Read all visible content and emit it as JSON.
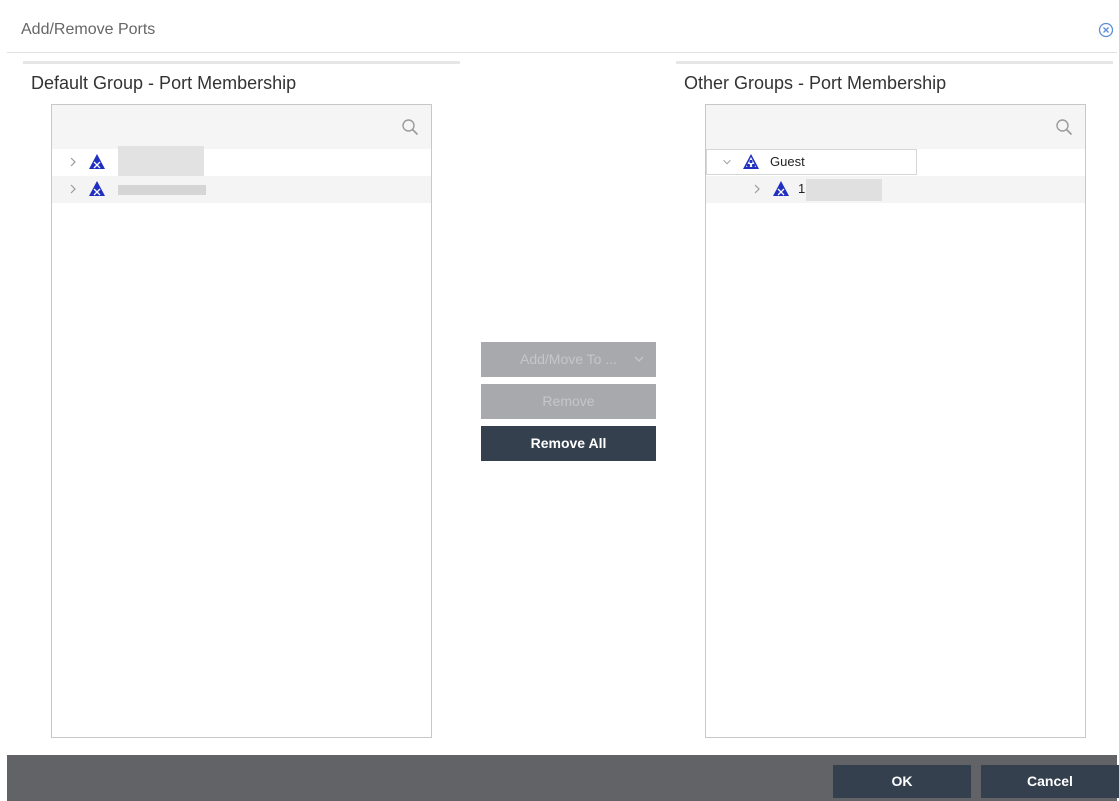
{
  "dialog": {
    "title": "Add/Remove Ports",
    "close_icon": "close-circle-icon"
  },
  "left_panel": {
    "heading": "Default Group - Port Membership",
    "search": {
      "value": "",
      "placeholder": ""
    },
    "nodes": [
      {
        "label": "",
        "expanded": false,
        "icon": "device-icon"
      },
      {
        "label": "",
        "expanded": false,
        "icon": "device-icon"
      }
    ]
  },
  "right_panel": {
    "heading": "Other Groups - Port Membership",
    "search": {
      "value": "",
      "placeholder": ""
    },
    "nodes": [
      {
        "label": "Guest",
        "expanded": true,
        "icon": "group-icon",
        "children": [
          {
            "label": "1",
            "expanded": false,
            "icon": "device-icon"
          }
        ]
      }
    ]
  },
  "actions": {
    "add_move_label": "Add/Move To ...",
    "remove_label": "Remove",
    "remove_all_label": "Remove All"
  },
  "footer": {
    "ok_label": "OK",
    "cancel_label": "Cancel"
  },
  "colors": {
    "primary_button": "#34404e",
    "disabled_button": "#a7a9ac",
    "footer_bar": "#626366",
    "icon_blue": "#1f2fbf"
  }
}
